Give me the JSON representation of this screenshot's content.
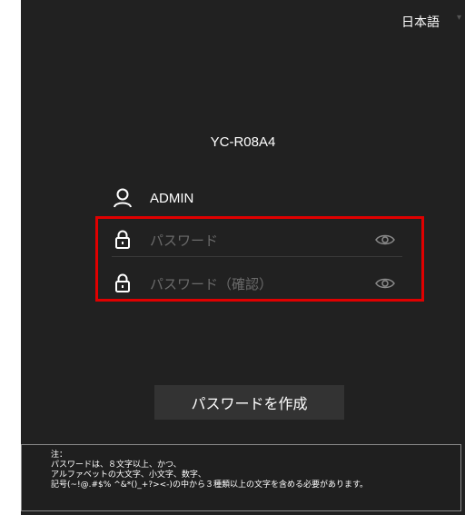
{
  "language": {
    "label": "日本語",
    "caret": "▾"
  },
  "device_name": "YC-R08A4",
  "user": {
    "name": "ADMIN",
    "icon": "user-icon"
  },
  "password": {
    "placeholder": "パスワード",
    "icon": "lock-icon",
    "toggle_icon": "eye-icon"
  },
  "password_confirm": {
    "placeholder": "パスワード（確認）",
    "icon": "lock-icon",
    "toggle_icon": "eye-icon"
  },
  "create_button": {
    "label": "パスワードを作成"
  },
  "note": {
    "title": "注：",
    "line1": "パスワードは、８文字以上、かつ、",
    "line2": "アルファベットの大文字、小文字、数字、",
    "line3": "記号(~!@.#$% ^&*()_+?><-)の中から３種類以上の文字を含める必要があります。"
  },
  "colors": {
    "background": "#212121",
    "highlight": "#e00000",
    "button": "#333333",
    "text": "#ffffff",
    "placeholder": "#6b6b6b"
  }
}
